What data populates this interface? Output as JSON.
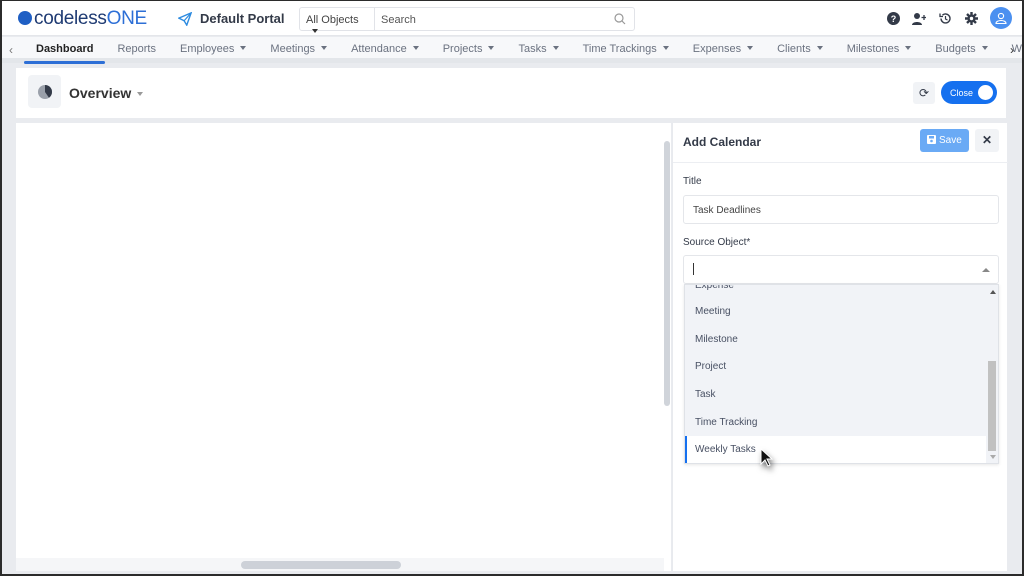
{
  "app": {
    "logo_text": "codeless",
    "logo_accent": "ONE",
    "portal": "Default Portal"
  },
  "search": {
    "scope": "All Objects",
    "placeholder": "Search"
  },
  "top_icons": [
    "help-icon",
    "add-user-icon",
    "history-icon",
    "gear-icon",
    "avatar-icon"
  ],
  "nav": {
    "items": [
      {
        "label": "Dashboard",
        "active": true,
        "dropdown": false
      },
      {
        "label": "Reports",
        "dropdown": false
      },
      {
        "label": "Employees",
        "dropdown": true
      },
      {
        "label": "Meetings",
        "dropdown": true
      },
      {
        "label": "Attendance",
        "dropdown": true
      },
      {
        "label": "Projects",
        "dropdown": true
      },
      {
        "label": "Tasks",
        "dropdown": true
      },
      {
        "label": "Time Trackings",
        "dropdown": true
      },
      {
        "label": "Expenses",
        "dropdown": true
      },
      {
        "label": "Clients",
        "dropdown": true
      },
      {
        "label": "Milestones",
        "dropdown": true
      },
      {
        "label": "Budgets",
        "dropdown": true
      },
      {
        "label": "W",
        "dropdown": false
      }
    ]
  },
  "header": {
    "title": "Overview",
    "toggle_label": "Close"
  },
  "panel": {
    "title": "Add Calendar",
    "save_label": "Save",
    "title_label": "Title",
    "title_value": "Task Deadlines",
    "source_label": "Source Object*",
    "options": [
      "Expense",
      "Meeting",
      "Milestone",
      "Project",
      "Task",
      "Time Tracking",
      "Weekly Tasks"
    ],
    "hovered_option": "Weekly Tasks"
  },
  "colors": {
    "accent": "#1570ef",
    "save": "#6aaaf5"
  }
}
